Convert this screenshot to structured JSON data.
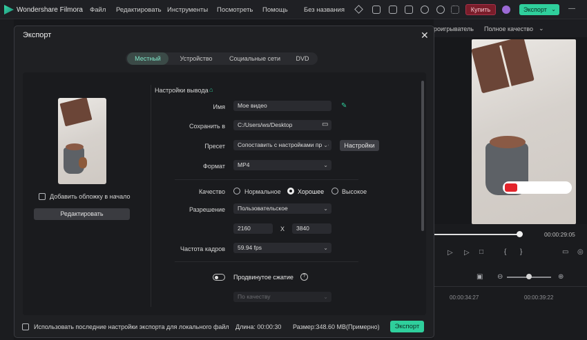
{
  "app": {
    "name": "Wondershare Filmora",
    "menu": [
      "Файл",
      "Редактировать",
      "Инструменты",
      "Посмотреть",
      "Помощь"
    ],
    "project_title": "Без названия",
    "buy_label": "Купить",
    "export_label": "Экспорт"
  },
  "preview": {
    "playback_label": "роигрыватель",
    "quality": "Полное качество",
    "timecode": "00:00:29:05",
    "timeline_marks": [
      "00:00:34:27",
      "00:00:39:22"
    ]
  },
  "dialog": {
    "title": "Экспорт",
    "tabs": [
      {
        "label": "Местный",
        "active": true
      },
      {
        "label": "Устройство",
        "active": false
      },
      {
        "label": "Социальные сети",
        "active": false
      },
      {
        "label": "DVD",
        "active": false
      }
    ],
    "left": {
      "add_cover_label": "Добавить обложку в начало",
      "add_cover_checked": false,
      "edit_button": "Редактировать"
    },
    "settings": {
      "section_title": "Настройки вывода",
      "name_label": "Имя",
      "name_value": "Мое видео",
      "save_label": "Сохранить в",
      "save_value": "C:/Users/ws/Desktop",
      "preset_label": "Пресет",
      "preset_value": "Сопоставить с настройками прое",
      "preset_settings_button": "Настройки",
      "format_label": "Формат",
      "format_value": "MP4",
      "quality_label": "Качество",
      "quality_options": [
        "Нормальное",
        "Хорошее",
        "Высокое"
      ],
      "quality_selected": "Хорошее",
      "resolution_label": "Разрешение",
      "resolution_value": "Пользовательское",
      "width": "2160",
      "height": "3840",
      "x_label": "X",
      "framerate_label": "Частота кадров",
      "framerate_value": "59.94 fps",
      "advanced_label": "Продвинутое сжатие",
      "advanced_on": false,
      "compression_value": "По качеству"
    },
    "footer": {
      "use_last_label": "Использовать последние настройки экспорта для локального файл",
      "use_last_checked": false,
      "duration": "Длина: 00:00:30",
      "size": "Размер:348.60 MB(Примерно)",
      "export_button": "Экспорт"
    }
  },
  "colors": {
    "accent": "#2fcf9c",
    "active_tab_text": "#7fe6c8",
    "buy": "#7a1d2a"
  }
}
